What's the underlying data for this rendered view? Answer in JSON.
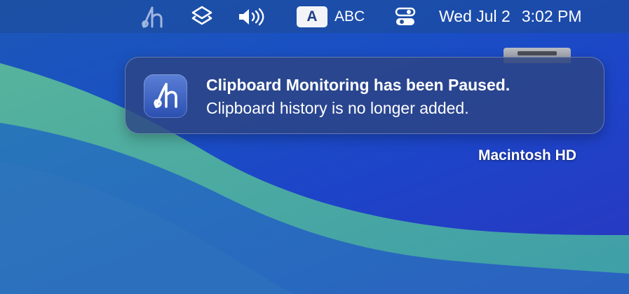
{
  "menubar": {
    "app_icon": "handoff-clipboard-icon",
    "icons": [
      "layers-icon",
      "volume-icon",
      "control-center-icon"
    ],
    "input_source_badge": "A",
    "input_source_name": "ABC",
    "date": "Wed Jul 2",
    "time": "3:02 PM"
  },
  "desktop": {
    "drive_label": "Macintosh HD"
  },
  "notification": {
    "title": "Clipboard Monitoring has been Paused.",
    "body": "Clipboard history is no longer added.",
    "icon": "clipboard-app-icon"
  }
}
